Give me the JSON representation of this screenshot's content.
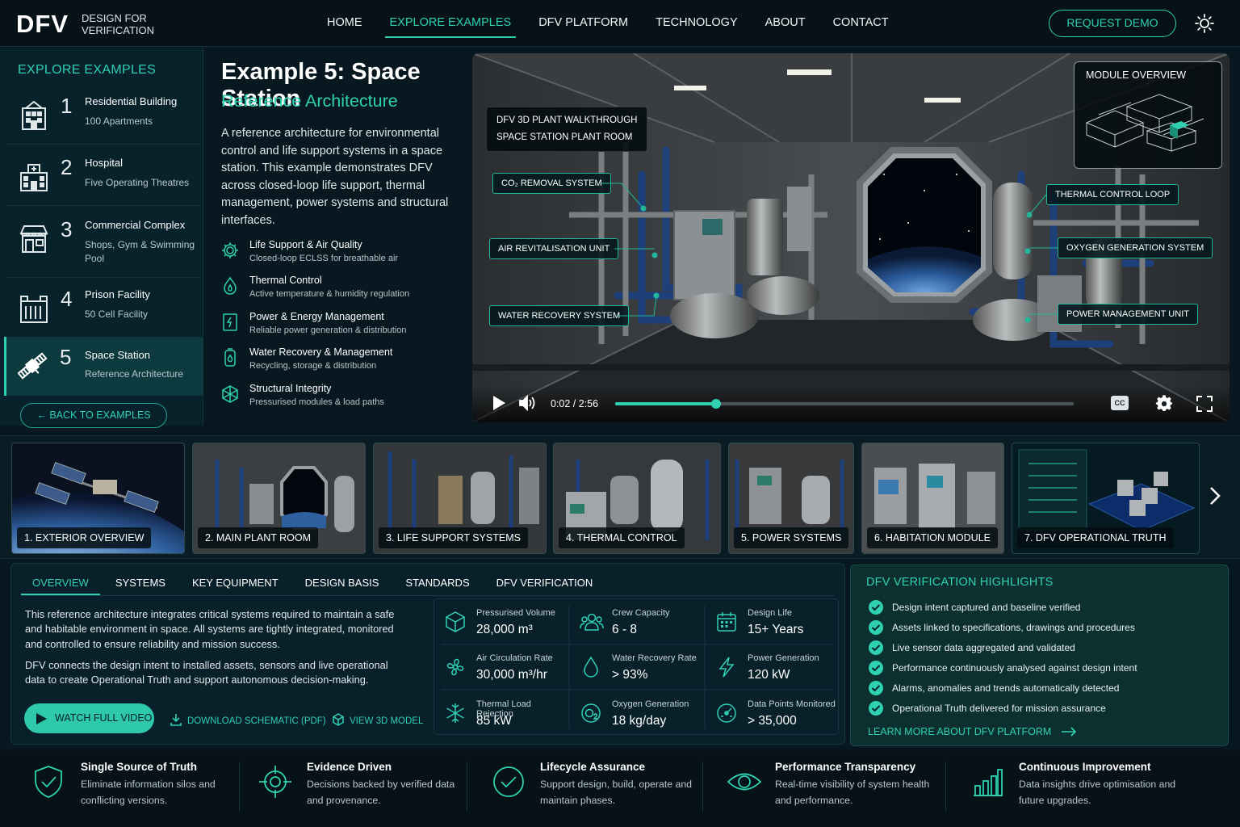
{
  "header": {
    "logo": "DFV",
    "logo_sub_1": "DESIGN FOR",
    "logo_sub_2": "VERIFICATION",
    "nav": [
      "HOME",
      "EXPLORE EXAMPLES",
      "DFV PLATFORM",
      "TECHNOLOGY",
      "ABOUT",
      "CONTACT"
    ],
    "active_nav": "EXPLORE EXAMPLES",
    "demo_button": "REQUEST DEMO",
    "theme_icon": "sun-icon"
  },
  "sidebar": {
    "title": "EXPLORE EXAMPLES",
    "items": [
      {
        "num": "1",
        "title": "Residential Building",
        "sub": "100 Apartments",
        "icon": "residential-building-icon"
      },
      {
        "num": "2",
        "title": "Hospital",
        "sub": "Five Operating Theatres",
        "icon": "hospital-icon"
      },
      {
        "num": "3",
        "title": "Commercial Complex",
        "sub": "Shops, Gym & Swimming Pool",
        "icon": "storefront-icon"
      },
      {
        "num": "4",
        "title": "Prison Facility",
        "sub": "50 Cell Facility",
        "icon": "prison-icon"
      },
      {
        "num": "5",
        "title": "Space Station",
        "sub": "Reference Architecture",
        "icon": "satellite-icon"
      }
    ],
    "active_index": 4,
    "back_button": "← BACK TO EXAMPLES"
  },
  "main": {
    "title": "Example 5: Space Station",
    "subtitle": "Reference Architecture",
    "description": "A reference architecture for environmental control and life support systems in a space station. This example demonstrates DFV across closed-loop life support, thermal management, power systems and structural interfaces.",
    "features": [
      {
        "title": "Life Support & Air Quality",
        "sub": "Closed-loop ECLSS for breathable air",
        "icon": "gear-icon"
      },
      {
        "title": "Thermal Control",
        "sub": "Active temperature & humidity regulation",
        "icon": "droplet-flame-icon"
      },
      {
        "title": "Power & Energy Management",
        "sub": "Reliable power generation & distribution",
        "icon": "power-panel-icon"
      },
      {
        "title": "Water Recovery & Management",
        "sub": "Recycling, storage & distribution",
        "icon": "water-tank-icon"
      },
      {
        "title": "Structural Integrity",
        "sub": "Pressurised modules & load paths",
        "icon": "structure-icon"
      }
    ]
  },
  "video": {
    "walkthrough_line1": "DFV 3D PLANT WALKTHROUGH",
    "walkthrough_line2": "SPACE STATION PLANT ROOM",
    "callouts_left": [
      "CO₂ REMOVAL SYSTEM",
      "AIR REVITALISATION UNIT",
      "WATER RECOVERY SYSTEM"
    ],
    "callouts_right": [
      "THERMAL CONTROL LOOP",
      "OXYGEN GENERATION SYSTEM",
      "POWER MANAGEMENT UNIT"
    ],
    "module_overview": "MODULE OVERVIEW",
    "time": "0:02 / 2:56",
    "progress": 0.22,
    "cc": "CC"
  },
  "thumbnails": [
    "1. EXTERIOR OVERVIEW",
    "2. MAIN PLANT ROOM",
    "3. LIFE SUPPORT SYSTEMS",
    "4. THERMAL CONTROL",
    "5. POWER SYSTEMS",
    "6. HABITATION MODULE",
    "7. DFV OPERATIONAL TRUTH"
  ],
  "tabs": {
    "items": [
      "OVERVIEW",
      "SYSTEMS",
      "KEY EQUIPMENT",
      "DESIGN BASIS",
      "STANDARDS",
      "DFV VERIFICATION"
    ],
    "active": "OVERVIEW",
    "para1": "This reference architecture integrates critical systems required to maintain a safe and habitable environment in space. All systems are tightly integrated, monitored and controlled to ensure reliability and mission success.",
    "para2": "DFV connects the design intent to installed assets, sensors and live operational data to create Operational Truth and support autonomous decision-making.",
    "watch_button": "WATCH FULL VIDEO",
    "download_link": "DOWNLOAD SCHEMATIC (PDF)",
    "model_link": "VIEW 3D MODEL"
  },
  "stats": [
    {
      "label": "Pressurised Volume",
      "value": "28,000 m³",
      "icon": "cube-icon"
    },
    {
      "label": "Crew Capacity",
      "value": "6 - 8",
      "icon": "crew-icon"
    },
    {
      "label": "Design Life",
      "value": "15+ Years",
      "icon": "calendar-icon"
    },
    {
      "label": "Air Circulation Rate",
      "value": "30,000 m³/hr",
      "icon": "fan-icon"
    },
    {
      "label": "Water Recovery Rate",
      "value": "> 93%",
      "icon": "droplet-icon"
    },
    {
      "label": "Power Generation",
      "value": "120 kW",
      "icon": "lightning-icon"
    },
    {
      "label": "Thermal Load Rejection",
      "value": "85 kW",
      "icon": "snowflake-icon"
    },
    {
      "label": "Oxygen Generation",
      "value": "18 kg/day",
      "icon": "o2-icon"
    },
    {
      "label": "Data Points Monitored",
      "value": "> 35,000",
      "icon": "data-gauge-icon"
    }
  ],
  "highlights": {
    "title": "DFV VERIFICATION HIGHLIGHTS",
    "items": [
      "Design intent captured and baseline verified",
      "Assets linked to specifications, drawings and procedures",
      "Live sensor data aggregated and validated",
      "Performance continuously analysed against design intent",
      "Alarms, anomalies and trends automatically detected",
      "Operational Truth delivered for mission assurance"
    ],
    "link": "LEARN MORE ABOUT DFV PLATFORM"
  },
  "footer": [
    {
      "title": "Single Source of Truth",
      "sub": "Eliminate information silos and conflicting versions.",
      "icon": "shield-check-icon"
    },
    {
      "title": "Evidence Driven",
      "sub": "Decisions backed by verified data and provenance.",
      "icon": "target-icon"
    },
    {
      "title": "Lifecycle Assurance",
      "sub": "Support design, build, operate and maintain phases.",
      "icon": "check-circle-icon"
    },
    {
      "title": "Performance Transparency",
      "sub": "Real-time visibility of system health and performance.",
      "icon": "eye-icon"
    },
    {
      "title": "Continuous Improvement",
      "sub": "Data insights drive optimisation and future upgrades.",
      "icon": "bar-chart-icon"
    }
  ]
}
